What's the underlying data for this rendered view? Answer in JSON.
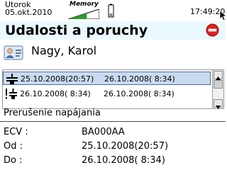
{
  "status_bar": {
    "day": "Utorok",
    "date": "05.okt.2010",
    "memory_label": "Memory",
    "memory_level": 0.6,
    "time": "17:49:20"
  },
  "header": {
    "title": "Udalosti a poruchy",
    "stop_icon": "stop-sign-icon"
  },
  "user": {
    "name": "Nagy, Karol",
    "icon": "user-card-icon"
  },
  "events": [
    {
      "icon": "power-plug-icon",
      "from": "25.10.2008(20:57)",
      "to": "26.10.2008( 8:34)",
      "selected": true
    },
    {
      "icon": "warning-power-icon",
      "from": "26.10.2008( 8:34)",
      "to": "26.10.2008( 8:34)",
      "selected": false
    }
  ],
  "detail": {
    "title": "Prerušenie napájania",
    "ecv_label": "ECV :",
    "ecv_value": "BA000AA",
    "od_label": "Od :",
    "od_value": "25.10.2008(20:57)",
    "do_label": "Do :",
    "do_value": "26.10.2008( 8:34)"
  },
  "colors": {
    "title_bg": "#eaf9fd",
    "selection_bg": "#c9dbf0",
    "memory_green": "#2e9b2e",
    "stop_red": "#e02020"
  }
}
